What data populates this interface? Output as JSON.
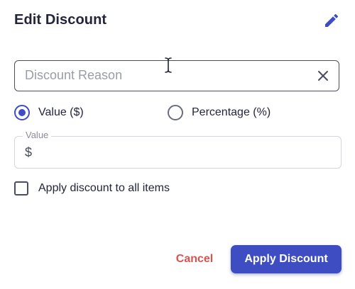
{
  "dialog": {
    "title": "Edit Discount",
    "title_icon": "pencil-icon"
  },
  "reason": {
    "placeholder": "Discount Reason",
    "value": "",
    "clear_icon": "close-icon"
  },
  "discount_type": {
    "options": [
      {
        "label": "Value ($)",
        "selected": true
      },
      {
        "label": "Percentage (%)",
        "selected": false
      }
    ]
  },
  "value_field": {
    "label": "Value",
    "prefix": "$",
    "value": ""
  },
  "apply_all": {
    "label": "Apply discount to all items",
    "checked": false
  },
  "actions": {
    "cancel_label": "Cancel",
    "apply_label": "Apply Discount"
  },
  "colors": {
    "accent": "#3f4dc3",
    "danger": "#d9534f",
    "text": "#23253a"
  }
}
